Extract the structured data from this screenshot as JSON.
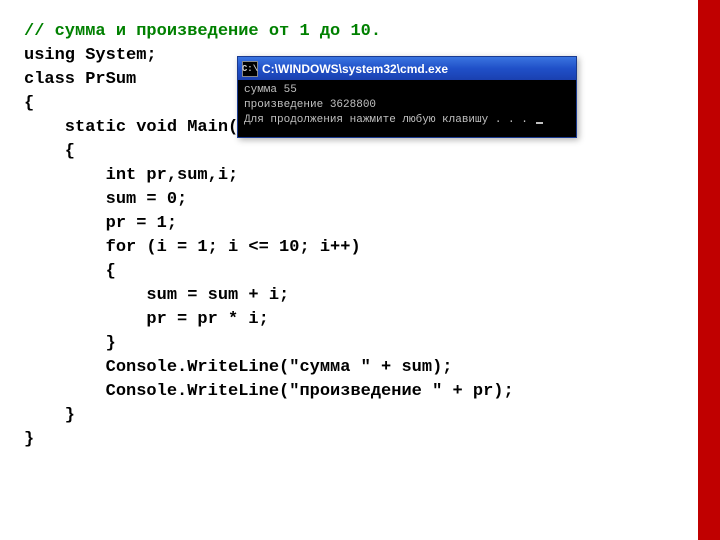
{
  "code": {
    "comment": "// сумма и произведение от 1 до 10.",
    "l1": "using System;",
    "l2": "",
    "l3": "class PrSum",
    "l4": "{",
    "l5": "    static void Main()",
    "l6": "    {",
    "l7": "        int pr,sum,i;",
    "l8": "        sum = 0;",
    "l9": "        pr = 1;",
    "l10": "",
    "l11": "        for (i = 1; i <= 10; i++)",
    "l12": "        {",
    "l13": "            sum = sum + i;",
    "l14": "            pr = pr * i;",
    "l15": "        }",
    "l16": "        Console.WriteLine(\"сумма \" + sum);",
    "l17": "        Console.WriteLine(\"произведение \" + pr);",
    "l18": "    }",
    "l19": "}"
  },
  "console": {
    "icon_text": "C:\\",
    "title": "C:\\WINDOWS\\system32\\cmd.exe",
    "out1": "сумма 55",
    "out2": "произведение 3628800",
    "out3": "Для продолжения нажмите любую клавишу . . . "
  }
}
